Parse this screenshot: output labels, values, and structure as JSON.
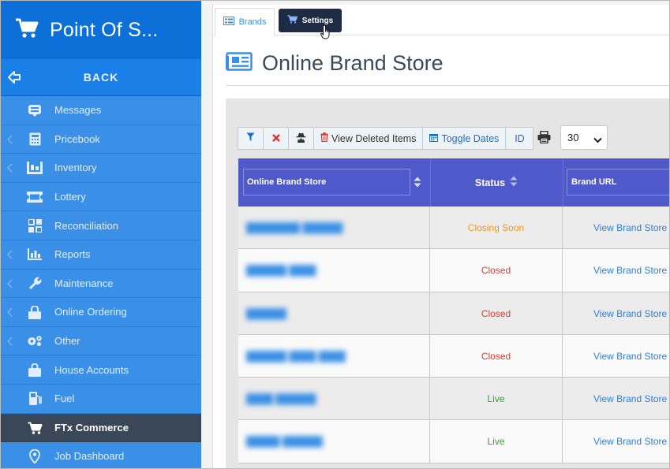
{
  "sidebar": {
    "title": "Point Of S...",
    "back_label": "BACK",
    "items": [
      {
        "label": "Messages",
        "icon": "messages-icon",
        "has_chevron": false
      },
      {
        "label": "Pricebook",
        "icon": "calculator-icon",
        "has_chevron": true
      },
      {
        "label": "Inventory",
        "icon": "inventory-icon",
        "has_chevron": true
      },
      {
        "label": "Lottery",
        "icon": "ticket-icon",
        "has_chevron": false
      },
      {
        "label": "Reconciliation",
        "icon": "grid-icon",
        "has_chevron": false
      },
      {
        "label": "Reports",
        "icon": "bar-chart-icon",
        "has_chevron": true
      },
      {
        "label": "Maintenance",
        "icon": "wrench-icon",
        "has_chevron": true
      },
      {
        "label": "Online Ordering",
        "icon": "lock-bag-icon",
        "has_chevron": true
      },
      {
        "label": "Other",
        "icon": "gears-icon",
        "has_chevron": true
      },
      {
        "label": "House Accounts",
        "icon": "bag-icon",
        "has_chevron": false
      },
      {
        "label": "Fuel",
        "icon": "fuel-pump-icon",
        "has_chevron": false
      },
      {
        "label": "FTx Commerce",
        "icon": "cart-icon",
        "has_chevron": false,
        "active": true
      },
      {
        "label": "Job Dashboard",
        "icon": "map-pin-icon",
        "has_chevron": false
      }
    ]
  },
  "tabs": {
    "brands": "Brands",
    "settings": "Settings"
  },
  "page": {
    "title": "Online Brand Store"
  },
  "toolbar": {
    "view_deleted": "View Deleted Items",
    "toggle_dates": "Toggle Dates",
    "id": "ID",
    "page_size": "30"
  },
  "table": {
    "headers": [
      "Online Brand Store",
      "Status",
      "Brand URL"
    ],
    "rows": [
      {
        "name": "",
        "status": "Closing Soon",
        "status_color": "#f0961b",
        "url": "View Brand Store"
      },
      {
        "name": "",
        "status": "Closed",
        "status_color": "#e03a2e",
        "url": "View Brand Store"
      },
      {
        "name": "",
        "status": "Closed",
        "status_color": "#e03a2e",
        "url": "View Brand Store"
      },
      {
        "name": "",
        "status": "Closed",
        "status_color": "#e03a2e",
        "url": "View Brand Store"
      },
      {
        "name": "",
        "status": "Live",
        "status_color": "#3a9a3a",
        "url": "View Brand Store"
      },
      {
        "name": "",
        "status": "Live",
        "status_color": "#3a9a3a",
        "url": "View Brand Store"
      }
    ]
  },
  "colors": {
    "sidebar_bg": "#3a8fe6",
    "sidebar_header": "#0d6fd8",
    "active_item": "#3a4759",
    "table_header": "#5059c9",
    "settings_tab": "#1d2b45"
  }
}
